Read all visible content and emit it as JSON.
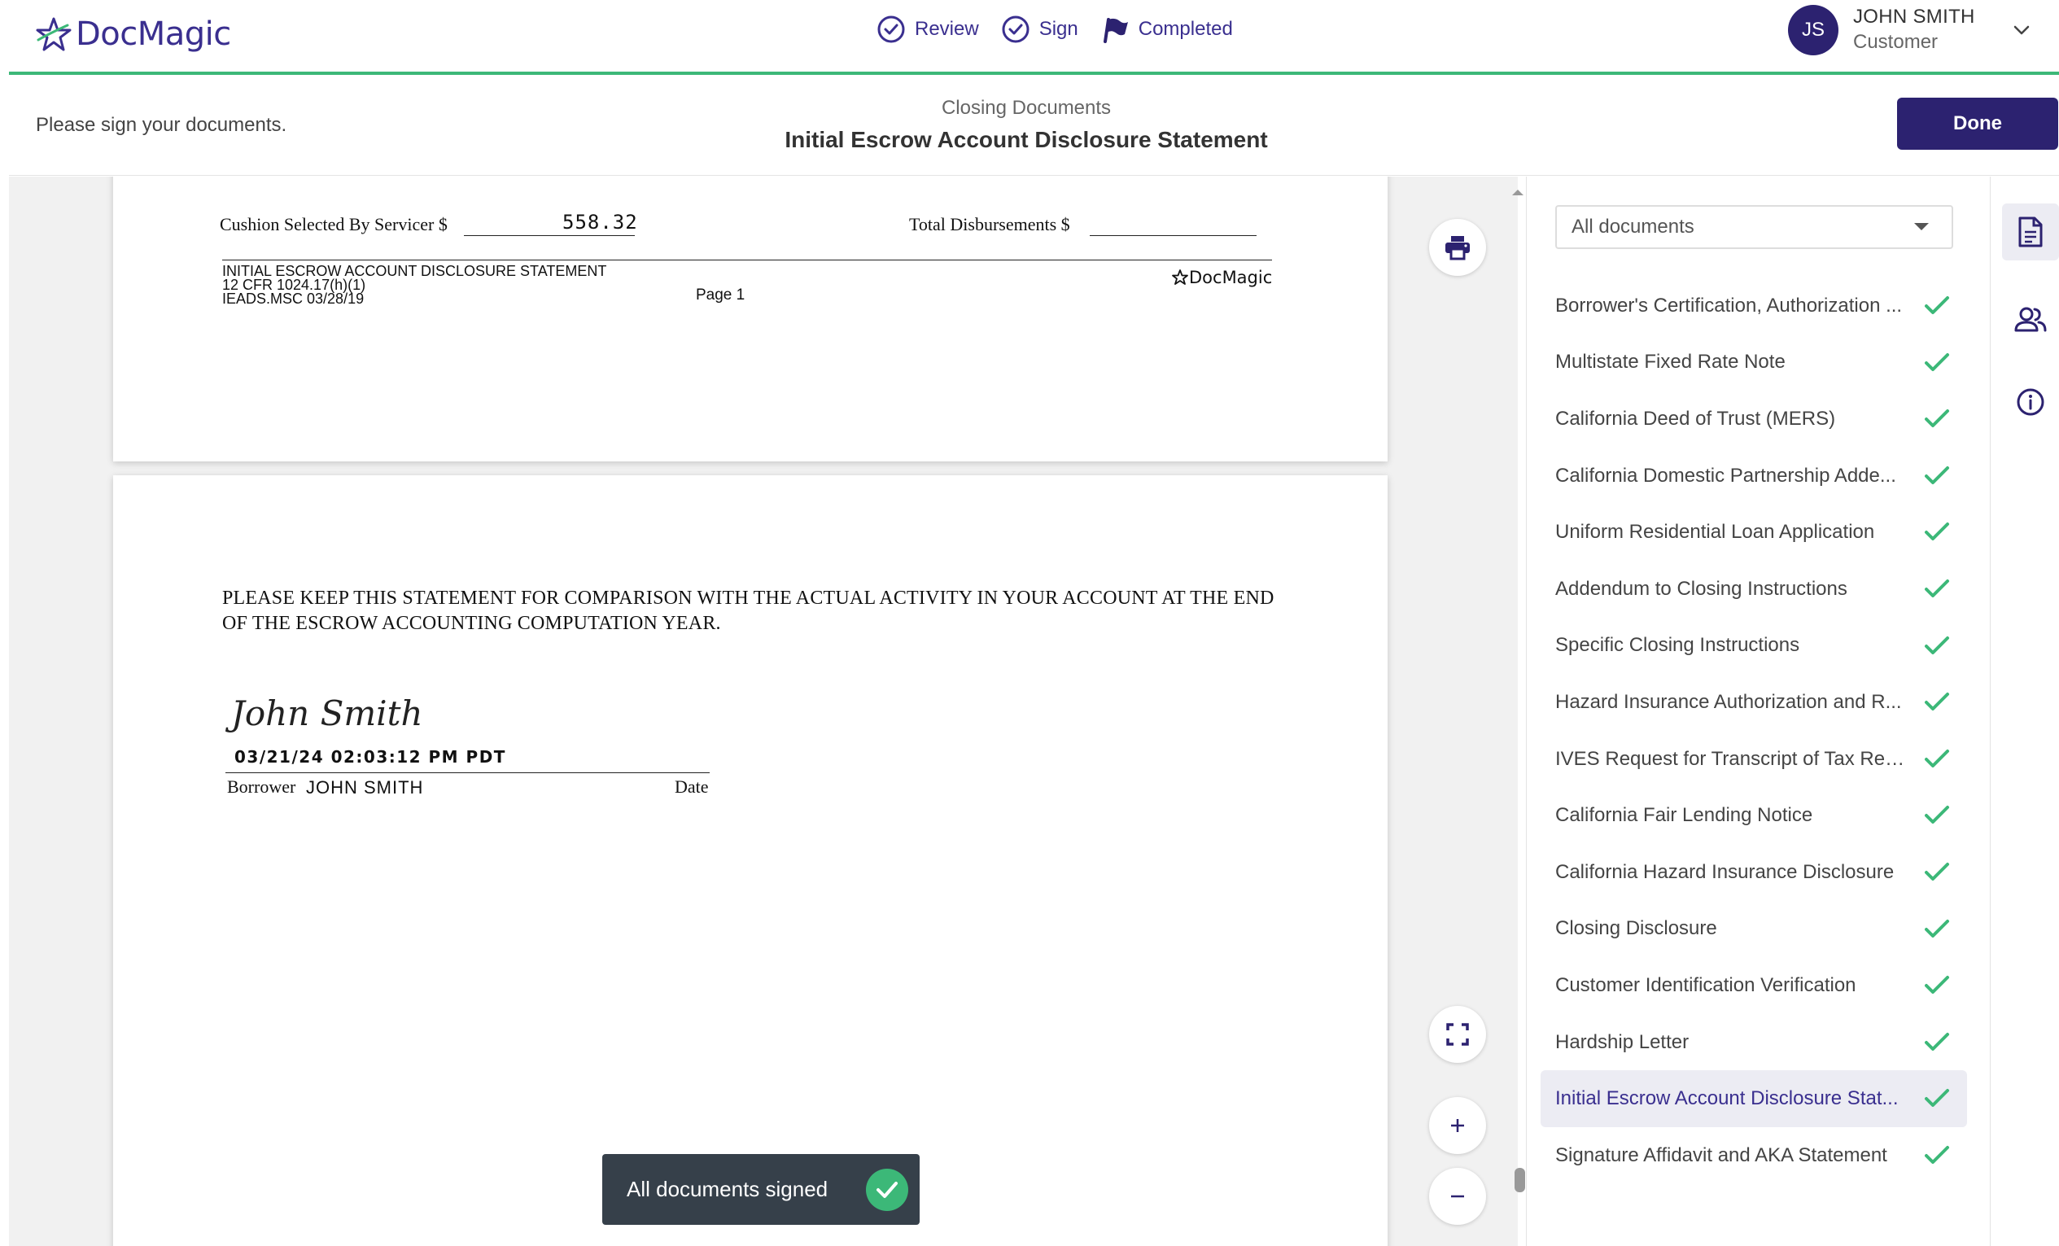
{
  "brand": {
    "name": "DocMagic"
  },
  "steps": [
    {
      "label": "Review",
      "icon": "check-circle-icon"
    },
    {
      "label": "Sign",
      "icon": "check-circle-icon"
    },
    {
      "label": "Completed",
      "icon": "flag-icon"
    }
  ],
  "user": {
    "initials": "JS",
    "name": "JOHN SMITH",
    "role": "Customer"
  },
  "subheader": {
    "instruction": "Please sign your documents.",
    "category": "Closing Documents",
    "title": "Initial Escrow Account Disclosure Statement",
    "done_label": "Done"
  },
  "page1": {
    "cushion_label": "Cushion Selected By Servicer $",
    "cushion_value": "558.32",
    "total_label": "Total Disbursements $",
    "footer_line1": "INITIAL  ESCROW  ACCOUNT  DISCLOSURE  STATEMENT",
    "footer_line2": "12  CFR  1024.17(h)(1)",
    "footer_line3": "IEADS.MSC    03/28/19",
    "page_label": "Page  1",
    "logo_text": "DocMagic"
  },
  "page2": {
    "statement": "PLEASE KEEP THIS STATEMENT FOR COMPARISON WITH  THE ACTUAL  ACTIVITY IN YOUR ACCOUNT AT THE END OF THE ESCROW ACCOUNTING COMPUTATION YEAR.",
    "signature": "John Smith",
    "timestamp": "03/21/24 02:03:12 PM PDT",
    "borrower_label": "Borrower",
    "borrower_name": "JOHN SMITH",
    "date_label": "Date"
  },
  "toast": {
    "message": "All documents signed"
  },
  "doc_filter": {
    "selected": "All documents"
  },
  "documents": [
    {
      "label": "Borrower's Certification, Authorization ...",
      "signed": true
    },
    {
      "label": "Multistate Fixed Rate Note",
      "signed": true
    },
    {
      "label": "California Deed of Trust (MERS)",
      "signed": true
    },
    {
      "label": "California Domestic Partnership Adde...",
      "signed": true
    },
    {
      "label": "Uniform Residential Loan Application",
      "signed": true
    },
    {
      "label": "Addendum to Closing Instructions",
      "signed": true
    },
    {
      "label": "Specific Closing Instructions",
      "signed": true
    },
    {
      "label": "Hazard Insurance Authorization and R...",
      "signed": true
    },
    {
      "label": "IVES Request for Transcript of Tax Ret...",
      "signed": true
    },
    {
      "label": "California Fair Lending Notice",
      "signed": true
    },
    {
      "label": "California Hazard Insurance Disclosure",
      "signed": true
    },
    {
      "label": "Closing Disclosure",
      "signed": true
    },
    {
      "label": "Customer Identification Verification",
      "signed": true
    },
    {
      "label": "Hardship Letter",
      "signed": true
    },
    {
      "label": "Initial Escrow Account Disclosure Stat...",
      "signed": true,
      "active": true
    },
    {
      "label": "Signature Affidavit and AKA Statement",
      "signed": true
    }
  ],
  "colors": {
    "brand": "#3a2f8f",
    "accent_green": "#3cb878",
    "done_button": "#2c2270"
  }
}
